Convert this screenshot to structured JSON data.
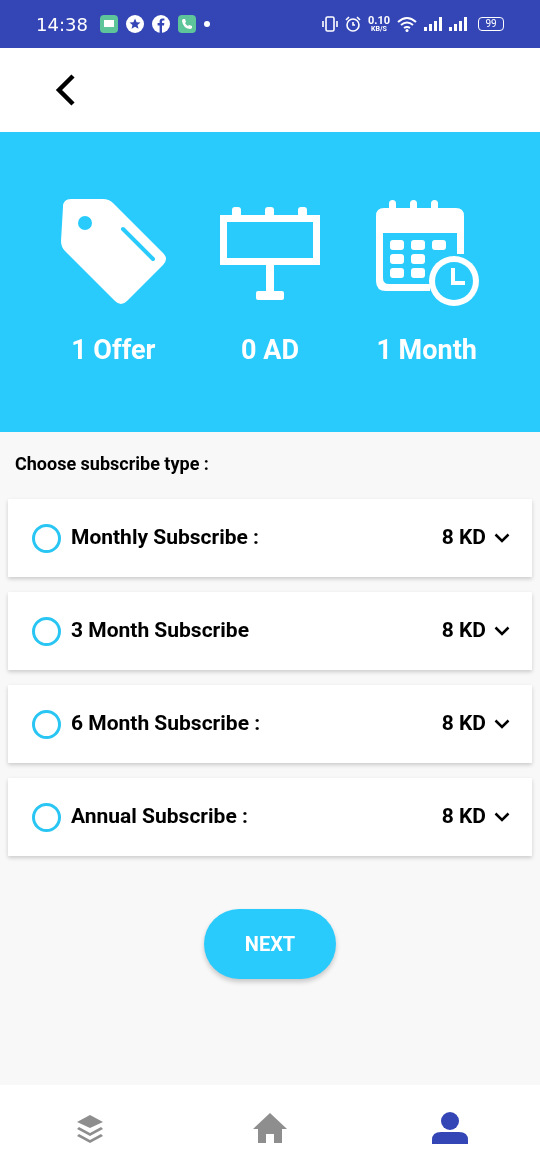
{
  "status_bar": {
    "time": "14:38",
    "speed": "0.10",
    "speed_unit": "KB/S",
    "battery": "99"
  },
  "stats": [
    {
      "kind": "tag",
      "label": "1 Offer"
    },
    {
      "kind": "billboard",
      "label": "0 AD"
    },
    {
      "kind": "calendar",
      "label": "1 Month"
    }
  ],
  "prompt": "Choose subscribe type :",
  "options": [
    {
      "title": "Monthly Subscribe :",
      "price": "8 KD",
      "selected": false
    },
    {
      "title": "3 Month Subscribe",
      "price": "8 KD",
      "selected": false
    },
    {
      "title": "6 Month Subscribe :",
      "price": "8 KD",
      "selected": false
    },
    {
      "title": "Annual Subscribe :",
      "price": "8 KD",
      "selected": false
    }
  ],
  "next_button": "NEXT",
  "bottom_nav": [
    {
      "kind": "layers",
      "selected": false
    },
    {
      "kind": "home",
      "selected": false
    },
    {
      "kind": "profile",
      "selected": true
    }
  ]
}
